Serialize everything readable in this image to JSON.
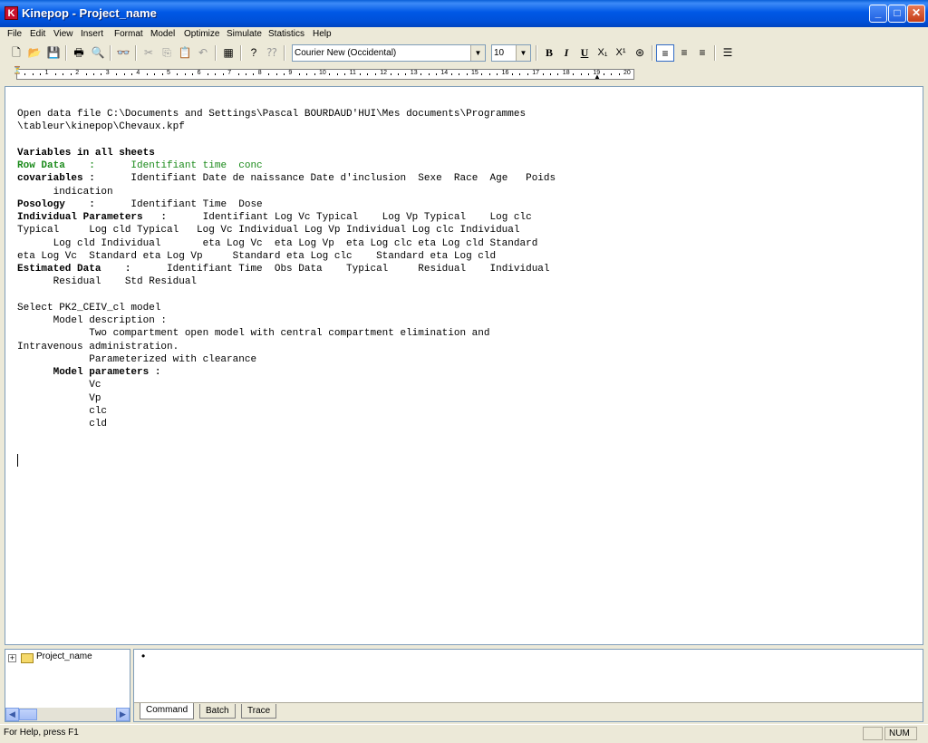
{
  "window": {
    "app_icon_letter": "K",
    "title": "Kinepop - Project_name"
  },
  "menu": [
    "File",
    "Edit",
    "View",
    "Insert",
    "Format",
    "Model",
    "Optimize",
    "Simulate",
    "Statistics",
    "Help"
  ],
  "toolbar": {
    "font_name": "Courier New (Occidental)",
    "font_size": "10",
    "bold_label": "B",
    "italic_label": "I",
    "underline_label": "U",
    "subscript_label": "X₁",
    "superscript_label": "X¹"
  },
  "ruler": {
    "numbers": [
      "1",
      "2",
      "3",
      "4",
      "5",
      "6",
      "7",
      "8",
      "9",
      "10",
      "11",
      "12",
      "13",
      "14",
      "15",
      "16",
      "17",
      "18",
      "19",
      "20"
    ]
  },
  "editor": {
    "lines": [
      "Open data file C:\\Documents and Settings\\Pascal BOURDAUD'HUI\\Mes documents\\Programmes",
      "\\tableur\\kinepop\\Chevaux.kpf",
      "",
      "Variables in all sheets",
      "Row Data    :      Identifiant time  conc",
      "covariables :      Identifiant Date de naissance Date d'inclusion  Sexe  Race  Age   Poids",
      "      indication",
      "Posology    :      Identifiant Time  Dose",
      "Individual Parameters   :      Identifiant Log Vc Typical    Log Vp Typical    Log clc",
      "Typical     Log cld Typical   Log Vc Individual Log Vp Individual Log clc Individual",
      "      Log cld Individual       eta Log Vc  eta Log Vp  eta Log clc eta Log cld Standard",
      "eta Log Vc  Standard eta Log Vp     Standard eta Log clc    Standard eta Log cld",
      "Estimated Data    :      Identifiant Time  Obs Data    Typical     Residual    Individual",
      "      Residual    Std Residual",
      "",
      "Select PK2_CEIV_cl model",
      "      Model description :",
      "            Two compartment open model with central compartment elimination and",
      "Intravenous administration.",
      "            Parameterized with clearance",
      "      Model parameters :",
      "            Vc",
      "            Vp",
      "            clc",
      "            cld"
    ],
    "bold_lines": [
      3,
      4,
      5,
      7,
      8,
      12,
      20
    ],
    "bold_prefix_len": {
      "4": "Row Data    :",
      "5": "covariables :",
      "7": "Posology    :",
      "8": "Individual Parameters   :",
      "12": "Estimated Data    :",
      "20": "      Model parameters :"
    },
    "green_line": 4
  },
  "tree": {
    "root": "Project_name"
  },
  "console": {
    "bullet": "•"
  },
  "tabs": [
    "Command",
    "Batch",
    "Trace"
  ],
  "status": {
    "help": "For Help, press F1",
    "num": "NUM"
  },
  "colors": {
    "title_blue": "#0058e6",
    "green_text": "#1a8a1a",
    "background": "#ece9d8"
  }
}
